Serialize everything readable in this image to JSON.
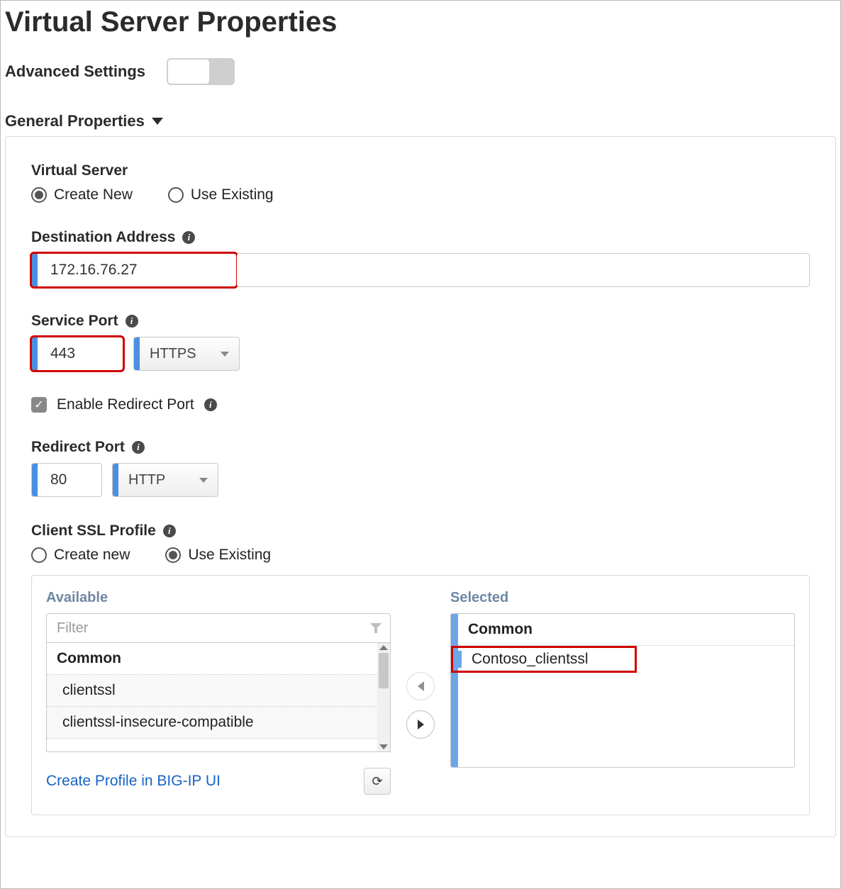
{
  "title": "Virtual Server Properties",
  "advanced": {
    "label": "Advanced Settings",
    "on": false
  },
  "section_general": "General Properties",
  "vs": {
    "label": "Virtual Server",
    "create_new": "Create New",
    "use_existing": "Use Existing",
    "selected": "create_new"
  },
  "dest": {
    "label": "Destination Address",
    "value": "172.16.76.27"
  },
  "sport": {
    "label": "Service Port",
    "value": "443",
    "proto": "HTTPS"
  },
  "redirect_enable": {
    "label": "Enable Redirect Port",
    "checked": true
  },
  "rport": {
    "label": "Redirect Port",
    "value": "80",
    "proto": "HTTP"
  },
  "ssl": {
    "label": "Client SSL Profile",
    "create_new": "Create new",
    "use_existing": "Use Existing",
    "selected": "use_existing"
  },
  "picker": {
    "available_label": "Available",
    "selected_label": "Selected",
    "filter_placeholder": "Filter",
    "group": "Common",
    "available": [
      "clientssl",
      "clientssl-insecure-compatible"
    ],
    "selected_group": "Common",
    "selected_items": [
      "Contoso_clientssl"
    ],
    "create_link": "Create Profile in BIG-IP UI"
  }
}
